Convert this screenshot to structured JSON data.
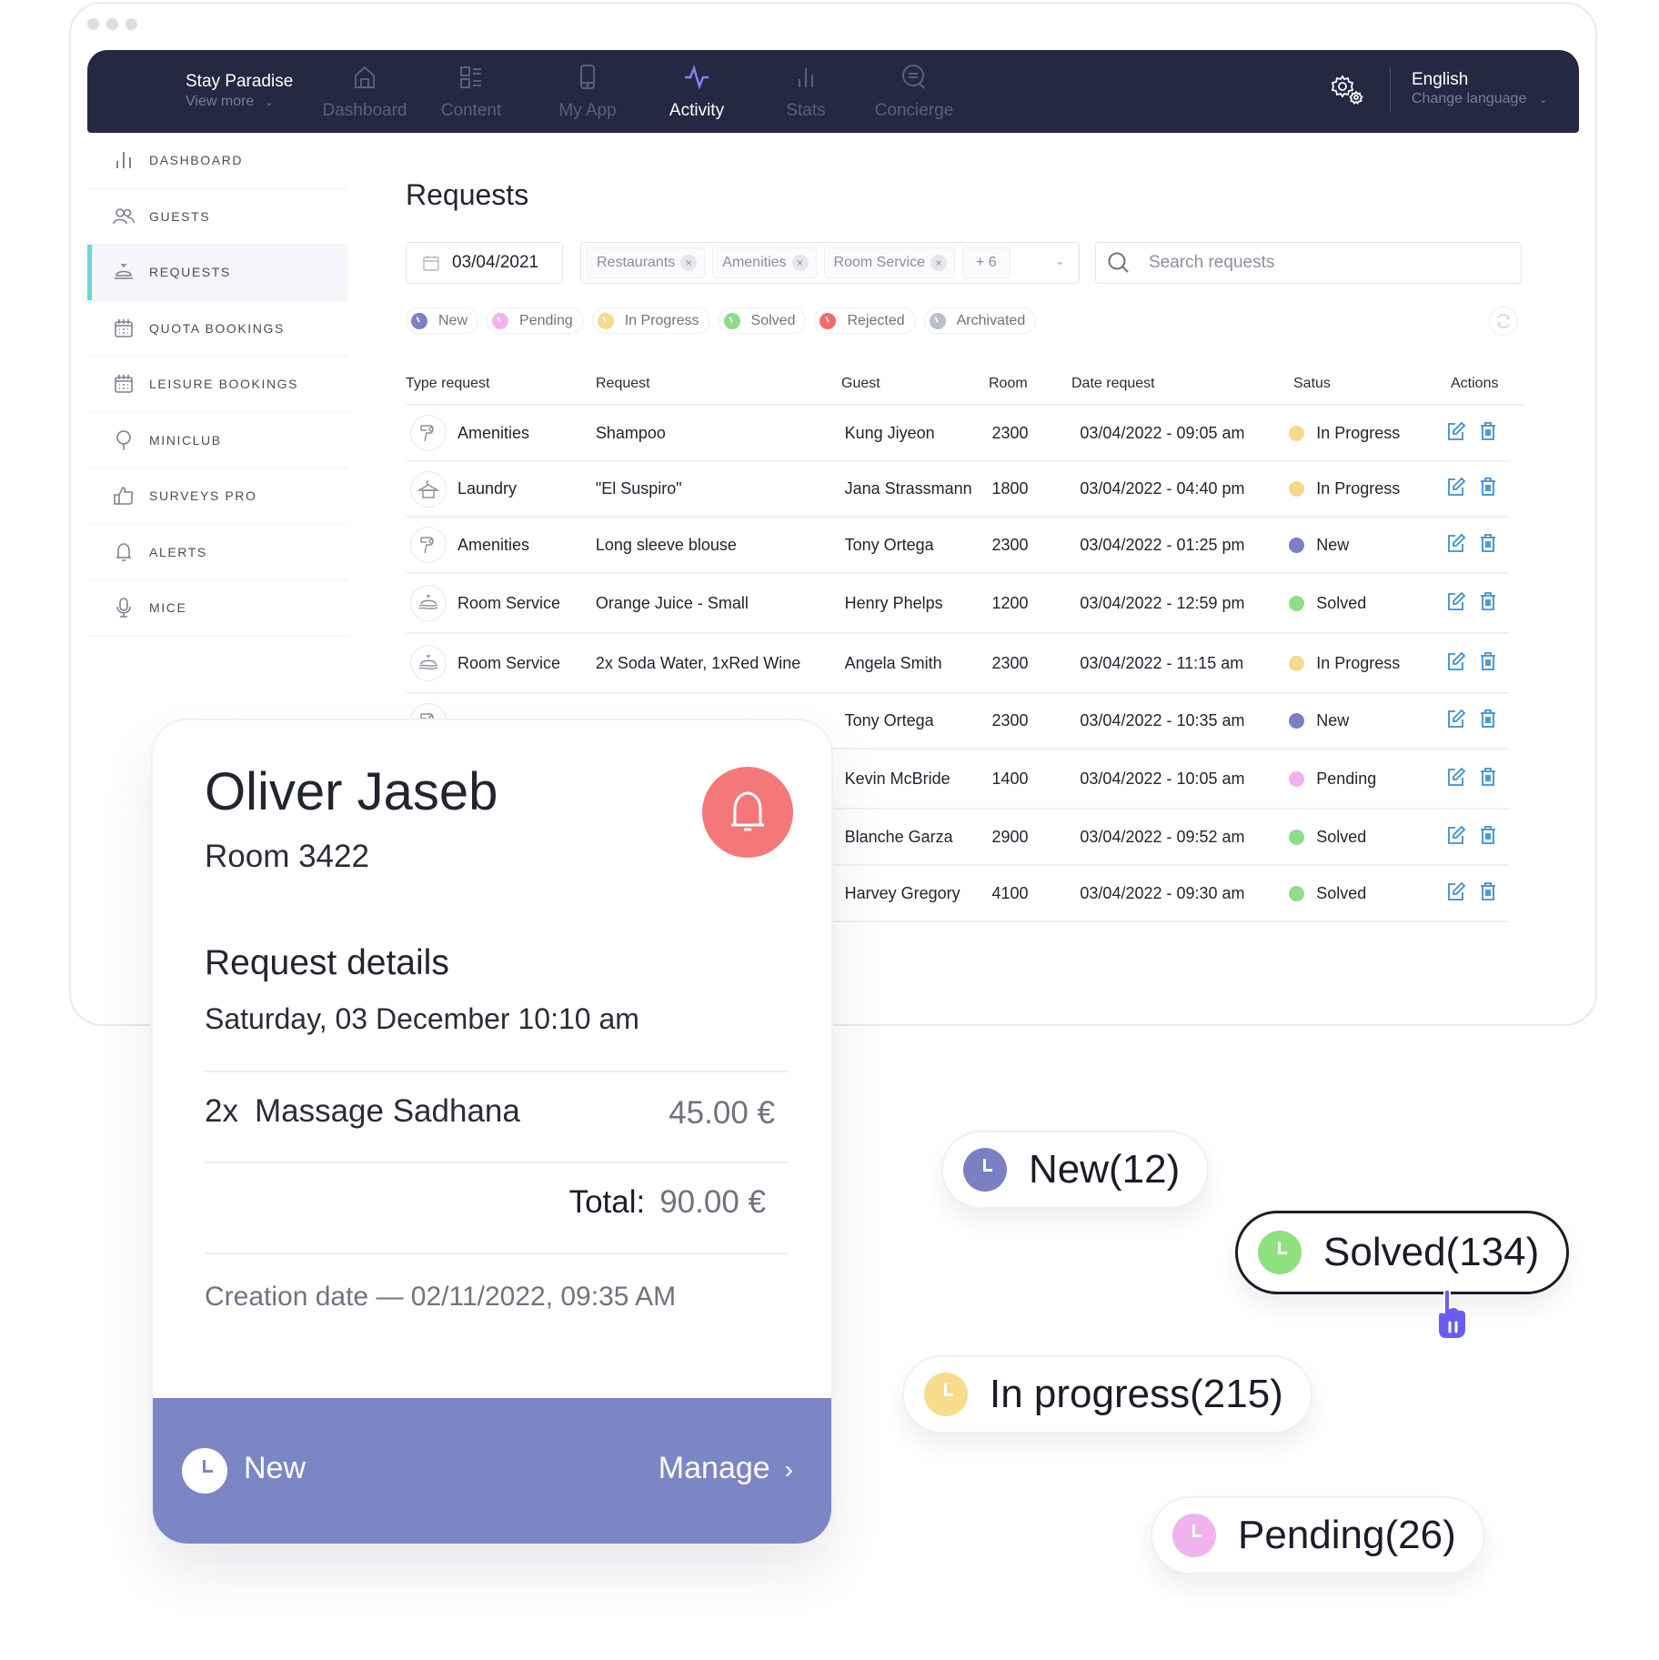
{
  "window": {
    "controls": [
      "dot",
      "dot",
      "dot"
    ]
  },
  "topnav": {
    "brand": {
      "name": "Stay Paradise",
      "sub": "View more"
    },
    "items": [
      {
        "label": "Dashboard",
        "icon": "home-icon",
        "active": false
      },
      {
        "label": "Content",
        "icon": "content-list-icon",
        "active": false
      },
      {
        "label": "My App",
        "icon": "phone-icon",
        "active": false
      },
      {
        "label": "Activity",
        "icon": "activity-pulse-icon",
        "active": true
      },
      {
        "label": "Stats",
        "icon": "bar-chart-icon",
        "active": false
      },
      {
        "label": "Concierge",
        "icon": "chat-icon",
        "active": false
      }
    ],
    "settings_icon": "gears-icon",
    "language": {
      "name": "English",
      "sub": "Change language"
    }
  },
  "sidebar": {
    "items": [
      {
        "label": "DASHBOARD",
        "icon": "bar-chart-icon",
        "active": false
      },
      {
        "label": "GUESTS",
        "icon": "users-icon",
        "active": false
      },
      {
        "label": "REQUESTS",
        "icon": "service-bell-icon",
        "active": true
      },
      {
        "label": "QUOTA BOOKINGS",
        "icon": "calendar-icon",
        "active": false
      },
      {
        "label": "LEISURE BOOKINGS",
        "icon": "calendar-icon",
        "active": false
      },
      {
        "label": "MINICLUB",
        "icon": "balloon-icon",
        "active": false
      },
      {
        "label": "SURVEYS PRO",
        "icon": "thumbs-up-icon",
        "active": false
      },
      {
        "label": "ALERTS",
        "icon": "bell-icon",
        "active": false
      },
      {
        "label": "MICE",
        "icon": "microphone-icon",
        "active": false
      }
    ]
  },
  "main": {
    "title": "Requests",
    "date_filter": "03/04/2021",
    "type_tags": [
      "Restaurants",
      "Amenities",
      "Room Service"
    ],
    "more_tags": "+ 6",
    "search": {
      "placeholder": "Search requests",
      "value": ""
    },
    "status_chips": [
      {
        "label": "New",
        "color": "#7b7fc4"
      },
      {
        "label": "Pending",
        "color": "#f0b3ee"
      },
      {
        "label": "In Progress",
        "color": "#f6d98a"
      },
      {
        "label": "Solved",
        "color": "#8fdc8a"
      },
      {
        "label": "Rejected",
        "color": "#f26b6b"
      },
      {
        "label": "Archivated",
        "color": "#b9bccb"
      }
    ],
    "table": {
      "headers": [
        "Type request",
        "Request",
        "Guest",
        "Room",
        "Date request",
        "Satus",
        "Actions"
      ],
      "rows": [
        {
          "type": "Amenities",
          "type_icon": "hair-dryer-icon",
          "request": "Shampoo",
          "guest": "Kung Jiyeon",
          "room": "2300",
          "date": "03/04/2022 - 09:05 am",
          "status": "In Progress",
          "status_color": "#f6d98a"
        },
        {
          "type": "Laundry",
          "type_icon": "hanger-icon",
          "request": "\"El Suspiro\"",
          "guest": "Jana Strassmann",
          "room": "1800",
          "date": "03/04/2022 - 04:40 pm",
          "status": "In Progress",
          "status_color": "#f6d98a"
        },
        {
          "type": "Amenities",
          "type_icon": "hair-dryer-icon",
          "request": "Long sleeve blouse",
          "guest": "Tony Ortega",
          "room": "2300",
          "date": "03/04/2022 - 01:25 pm",
          "status": "New",
          "status_color": "#7b7fc4"
        },
        {
          "type": "Room Service",
          "type_icon": "cloche-icon",
          "request": "Orange Juice - Small",
          "guest": "Henry Phelps",
          "room": "1200",
          "date": "03/04/2022 - 12:59 pm",
          "status": "Solved",
          "status_color": "#8fdc8a"
        },
        {
          "type": "Room Service",
          "type_icon": "cloche-icon",
          "request": "2x Soda Water,  1xRed Wine",
          "guest": "Angela Smith",
          "room": "2300",
          "date": "03/04/2022 - 11:15 am",
          "status": "In Progress",
          "status_color": "#f6d98a"
        },
        {
          "type": "",
          "type_icon": "hair-dryer-icon",
          "request": "",
          "guest": "Tony Ortega",
          "room": "2300",
          "date": "03/04/2022 - 10:35 am",
          "status": "New",
          "status_color": "#7b7fc4"
        },
        {
          "type": "",
          "type_icon": "",
          "request": "",
          "guest": "Kevin McBride",
          "room": "1400",
          "date": "03/04/2022 - 10:05 am",
          "status": "Pending",
          "status_color": "#f0b3ee"
        },
        {
          "type": "",
          "type_icon": "",
          "request": "",
          "guest": "Blanche Garza",
          "room": "2900",
          "date": "03/04/2022 - 09:52 am",
          "status": "Solved",
          "status_color": "#8fdc8a"
        },
        {
          "type": "",
          "type_icon": "",
          "request": "",
          "guest": "Harvey Gregory",
          "room": "4100",
          "date": "03/04/2022 - 09:30 am",
          "status": "Solved",
          "status_color": "#8fdc8a"
        }
      ]
    }
  },
  "request_card": {
    "guest_name": "Oliver Jaseb",
    "room": "Room 3422",
    "section_title": "Request details",
    "request_date": "Saturday, 03 December 10:10 am",
    "item_qty": "2x",
    "item_name": "Massage Sadhana",
    "item_price": "45.00 €",
    "total_label": "Total:",
    "total_value": "90.00 €",
    "creation": "Creation date — 02/11/2022, 09:35 AM",
    "status": "New",
    "manage_label": "Manage",
    "accent_color": "#7d86c4",
    "bell_color": "#f4787a"
  },
  "status_pills": [
    {
      "label": "New(12)",
      "color": "#7b7fc4",
      "selected": false
    },
    {
      "label": "Solved(134)",
      "color": "#8fe07e",
      "selected": true
    },
    {
      "label": "In progress(215)",
      "color": "#f6dc8c",
      "selected": false
    },
    {
      "label": "Pending(26)",
      "color": "#f0b3ee",
      "selected": false
    }
  ]
}
